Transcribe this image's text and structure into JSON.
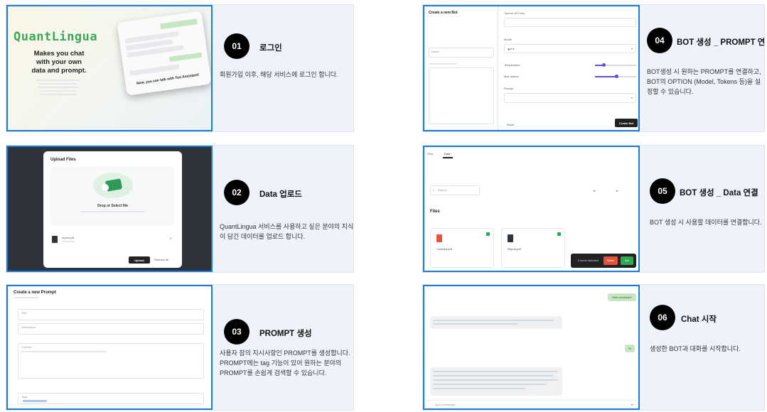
{
  "steps": [
    {
      "number": "01",
      "title": "로그인",
      "desc": "회원가입 이후, 해당 서비스에 로그인 합니다."
    },
    {
      "number": "02",
      "title": "Data 업로드",
      "desc": "QuantLingua 서비스를 사용하고 싶은 분야의 지식이 담긴 데이터를 업로드 합니다."
    },
    {
      "number": "03",
      "title": "PROMPT 생성",
      "desc": "사용자 참의 지시사항인 PROMPT를 생성합니다. PROMPT에는 tag 기능이 있어 원하는 분야의 PROMPT를 손쉽게 검색할 수 있습니다."
    },
    {
      "number": "04",
      "title": "BOT 생성 _ PROMPT 연결",
      "desc": "BOT생성 시 원하는 PROMPT를 연결하고, BOT의 OPTION (Model, Tokens 등)을 설정할 수 있습니다."
    },
    {
      "number": "05",
      "title": "BOT 생성 _ Data 연결",
      "desc": "BOT 생성 시 사용할 데이터를 연결합니다."
    },
    {
      "number": "06",
      "title": "Chat 시작",
      "desc": "생성한 BOT과 대화를 시작합니다."
    }
  ],
  "login": {
    "logo": "QuantLingua",
    "tagline_1": "Makes you chat",
    "tagline_2": "with your own",
    "tagline_3": "data and prompt.",
    "chat_caption": "Now, you can talk with Ton Assistant!"
  },
  "upload": {
    "modal_title": "Upload Files",
    "dropzone_title": "Drop or Select file",
    "file_name": "report.pdf",
    "upload_button": "Upload",
    "remove_all": "Remove all"
  },
  "prompt_form": {
    "title": "Create a new Prompt",
    "field_title": "Title",
    "field_description": "Description",
    "field_content": "Content",
    "tags_label": "Tags"
  },
  "bot_form": {
    "title": "Create a new Bot",
    "field_name": "Name",
    "openai_key": "OpenAI API Key",
    "model_label": "Model",
    "model_value": "gpt-4",
    "temperature_label": "Temperature",
    "max_tokens_label": "Max tokens",
    "prompt_label": "Prompt",
    "reset": "Reset",
    "create_button": "Create Bot"
  },
  "data_link": {
    "tab_1": "Files",
    "tab_2": "Data",
    "search_placeholder": "Search...",
    "files_heading": "Files",
    "file_1": "Contract.pdf",
    "file_2": "Report.pdf",
    "selected_text": "2 items selected",
    "delete_button": "Delete",
    "add_button": "Add"
  },
  "chat": {
    "msg_user_1": "Hello Assistant!",
    "msg_user_2": "Hi",
    "input_placeholder": "Type a message"
  },
  "colors": {
    "accent_border": "#1b7bd6",
    "logo_green": "#3aa85a",
    "dark_bg": "#2f3238",
    "button_dark": "#222222",
    "delete_red": "#e5533d",
    "add_green": "#2fa84f"
  }
}
